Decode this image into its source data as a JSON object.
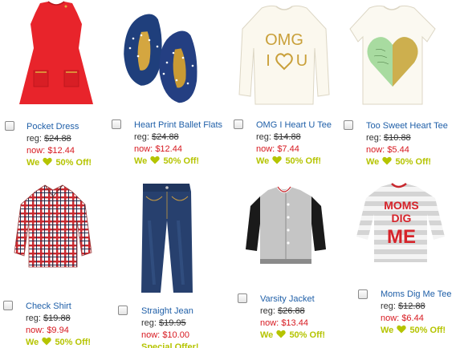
{
  "products": [
    {
      "name": "Pocket Dress",
      "reg_label": "reg:",
      "reg_price": "$24.88",
      "now_label": "now:",
      "now_price": "$12.44",
      "promo_pre": "We",
      "promo_post": "50% Off!",
      "image_icon": "red-dress-icon"
    },
    {
      "name": "Heart Print Ballet Flats",
      "reg_label": "reg:",
      "reg_price": "$24.88",
      "now_label": "now:",
      "now_price": "$12.44",
      "promo_pre": "We",
      "promo_post": "50% Off!",
      "image_icon": "ballet-flats-icon"
    },
    {
      "name": "OMG I Heart U Tee",
      "reg_label": "reg:",
      "reg_price": "$14.88",
      "now_label": "now:",
      "now_price": "$7.44",
      "promo_pre": "We",
      "promo_post": "50% Off!",
      "image_icon": "omg-tee-icon",
      "shirt_text_1": "OMG",
      "shirt_text_2": "I",
      "shirt_text_3": "U"
    },
    {
      "name": "Too Sweet Heart Tee",
      "reg_label": "reg:",
      "reg_price": "$10.88",
      "now_label": "now:",
      "now_price": "$5.44",
      "promo_pre": "We",
      "promo_post": "50% Off!",
      "image_icon": "heart-tee-icon"
    },
    {
      "name": "Check Shirt",
      "reg_label": "reg:",
      "reg_price": "$19.88",
      "now_label": "now:",
      "now_price": "$9.94",
      "promo_pre": "We",
      "promo_post": "50% Off!",
      "image_icon": "check-shirt-icon"
    },
    {
      "name": "Straight Jean",
      "reg_label": "reg:",
      "reg_price": "$19.95",
      "now_label": "now:",
      "now_price": "$10.00",
      "promo_special": "Special Offer!",
      "image_icon": "jeans-icon"
    },
    {
      "name": "Varsity Jacket",
      "reg_label": "reg:",
      "reg_price": "$26.88",
      "now_label": "now:",
      "now_price": "$13.44",
      "promo_pre": "We",
      "promo_post": "50% Off!",
      "image_icon": "varsity-jacket-icon"
    },
    {
      "name": "Moms Dig Me Tee",
      "reg_label": "reg:",
      "reg_price": "$12.88",
      "now_label": "now:",
      "now_price": "$6.44",
      "promo_pre": "We",
      "promo_post": "50% Off!",
      "image_icon": "moms-dig-me-tee-icon",
      "shirt_text_1": "MOMS",
      "shirt_text_2": "DIG",
      "shirt_text_3": "ME"
    }
  ],
  "colors": {
    "link": "#1f5fa8",
    "sale": "#d71920",
    "promo": "#b5c400"
  }
}
